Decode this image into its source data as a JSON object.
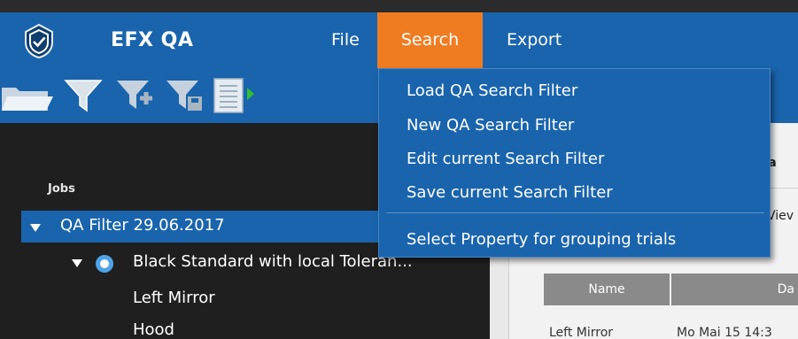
{
  "app": {
    "title": "EFX QA"
  },
  "menu": [
    {
      "label": "File"
    },
    {
      "label": "Search"
    },
    {
      "label": "Export"
    }
  ],
  "search_menu": {
    "items": [
      "Load QA Search Filter",
      "New QA Search Filter",
      "Edit current Search Filter",
      "Save current Search Filter",
      "Select Property for grouping trials"
    ]
  },
  "sidebar": {
    "section_label": "Jobs",
    "filter": "QA Filter 29.06.2017",
    "standard": "Black Standard with local Toleran...",
    "trials": [
      "Left Mirror",
      "Hood"
    ]
  },
  "content": {
    "tab_partial": "Ca",
    "view_partial": "Viev",
    "table": {
      "headers": [
        "Name",
        "Da"
      ],
      "rows": [
        [
          "Left Mirror",
          "Mo Mai 15 14:3"
        ]
      ]
    }
  },
  "colors": {
    "accent_blue": "#1a64ad",
    "active_menu": "#f07c22",
    "dark_panel": "#1f1f1f"
  },
  "icons": [
    "shield-logo-icon",
    "open-folder-icon",
    "filter-icon",
    "filter-add-icon",
    "filter-save-icon",
    "list-icon",
    "run-arrow-icon"
  ]
}
